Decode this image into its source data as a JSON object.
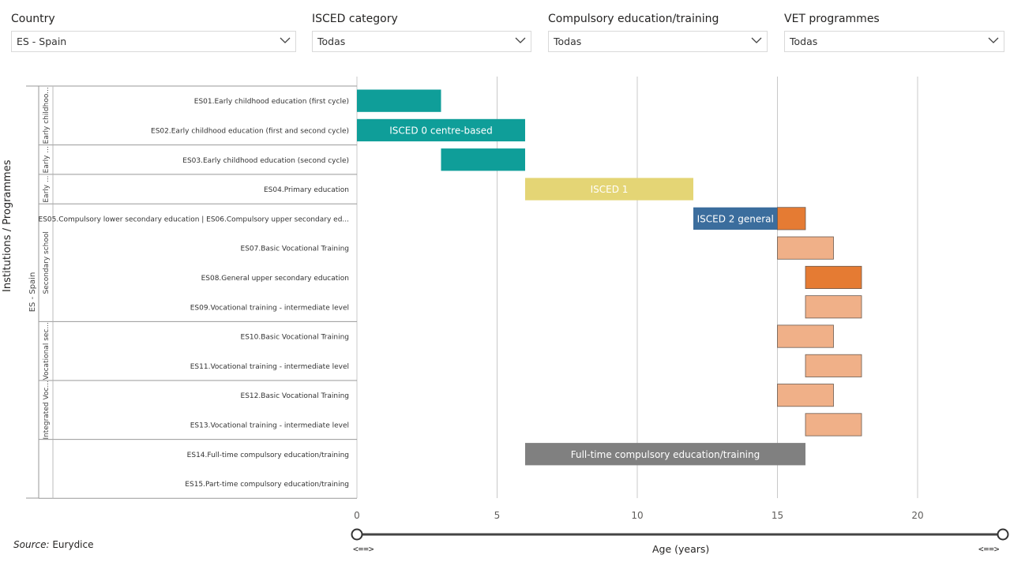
{
  "filters": [
    {
      "label": "Country",
      "value": "ES - Spain"
    },
    {
      "label": "ISCED category",
      "value": "Todas"
    },
    {
      "label": "Compulsory education/training",
      "value": "Todas"
    },
    {
      "label": "VET programmes",
      "value": "Todas"
    }
  ],
  "source": {
    "prefix": "Source:",
    "text": " Eurydice"
  },
  "chart_data": {
    "type": "bar",
    "orientation": "horizontal-range",
    "xlabel": "Age (years)",
    "ylabel": "Institutions / Programmes",
    "xlim": [
      0,
      23
    ],
    "xticks": [
      0,
      5,
      10,
      15,
      20
    ],
    "grid": true,
    "country_group": "ES - Spain",
    "groups": [
      {
        "label": "Early childhoo...",
        "rows": [
          0,
          1
        ]
      },
      {
        "label": "Early ...",
        "rows": [
          2
        ]
      },
      {
        "label": "Early ...",
        "rows": [
          3
        ]
      },
      {
        "label": "Secondary school",
        "rows": [
          4,
          5,
          6,
          7
        ]
      },
      {
        "label": "Vocational sec...",
        "rows": [
          8,
          9
        ]
      },
      {
        "label": "Integrated Voc...",
        "rows": [
          10,
          11
        ]
      },
      {
        "label": "",
        "rows": [
          12,
          13
        ]
      }
    ],
    "categories": [
      "ES01.Early childhood education (first cycle)",
      "ES02.Early childhood education (first and second cycle)",
      "ES03.Early childhood education (second cycle)",
      "ES04.Primary education",
      "ES05.Compulsory lower secondary education | ES06.Compulsory upper secondary ed...",
      "ES07.Basic Vocational Training",
      "ES08.General upper secondary education",
      "ES09.Vocational training - intermediate level",
      "ES10.Basic Vocational Training",
      "ES11.Vocational training - intermediate level",
      "ES12.Basic Vocational Training",
      "ES13.Vocational training - intermediate level",
      "ES14.Full-time compulsory education/training",
      "ES15.Part-time compulsory education/training"
    ],
    "bars": [
      {
        "row": 0,
        "start": 0,
        "end": 3,
        "color": "#0f9e99",
        "label": ""
      },
      {
        "row": 1,
        "start": 0,
        "end": 6,
        "color": "#0f9e99",
        "label": "ISCED 0 centre-based"
      },
      {
        "row": 2,
        "start": 3,
        "end": 6,
        "color": "#0f9e99",
        "label": ""
      },
      {
        "row": 3,
        "start": 6,
        "end": 12,
        "color": "#e4d575",
        "label": "ISCED 1"
      },
      {
        "row": 4,
        "start": 12,
        "end": 15,
        "color": "#3b6d9d",
        "label": "ISCED 2 general"
      },
      {
        "row": 4,
        "start": 15,
        "end": 16,
        "color": "#e57b33",
        "label": ""
      },
      {
        "row": 5,
        "start": 15,
        "end": 17,
        "color": "#f0b088",
        "label": ""
      },
      {
        "row": 6,
        "start": 16,
        "end": 18,
        "color": "#e57b33",
        "label": ""
      },
      {
        "row": 7,
        "start": 16,
        "end": 18,
        "color": "#f0b088",
        "label": ""
      },
      {
        "row": 8,
        "start": 15,
        "end": 17,
        "color": "#f0b088",
        "label": ""
      },
      {
        "row": 9,
        "start": 16,
        "end": 18,
        "color": "#f0b088",
        "label": ""
      },
      {
        "row": 10,
        "start": 15,
        "end": 17,
        "color": "#f0b088",
        "label": ""
      },
      {
        "row": 11,
        "start": 16,
        "end": 18,
        "color": "#f0b088",
        "label": ""
      },
      {
        "row": 12,
        "start": 6,
        "end": 16,
        "color": "#808080",
        "label": "Full-time compulsory education/training"
      }
    ],
    "slider": {
      "min_label": "<==>",
      "max_label": "<==>"
    }
  }
}
